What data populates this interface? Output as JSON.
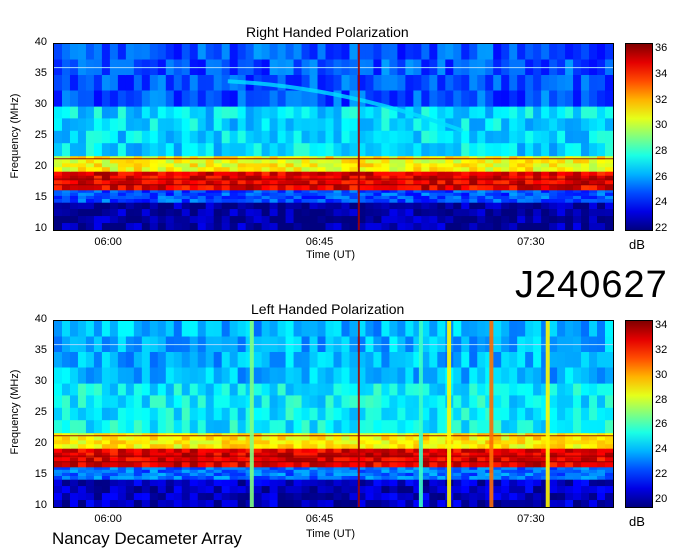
{
  "observation_id": "J240627",
  "footer": "Nancay Decameter Array",
  "colors": {
    "background": "#00007f",
    "low": "#00007f",
    "mid": "#00c8ff",
    "high": "#ffff00",
    "peak": "#8b0000"
  },
  "chart_data": [
    {
      "type": "heatmap",
      "title": "Right Handed Polarization",
      "xlabel": "Time (UT)",
      "ylabel": "Frequency (MHz)",
      "x_ticks": [
        "06:00",
        "06:45",
        "07:30"
      ],
      "y_ticks": [
        "10",
        "15",
        "20",
        "25",
        "30",
        "35",
        "40"
      ],
      "ylim": [
        10,
        40
      ],
      "xlim": [
        "05:48",
        "07:47"
      ],
      "colorbar": {
        "label": "dB",
        "ticks": [
          "36",
          "34",
          "32",
          "30",
          "28",
          "26",
          "24",
          "22"
        ],
        "range": [
          22,
          36.5
        ]
      },
      "bands": [
        {
          "freq": [
            10,
            14.5
          ],
          "level": 22.5
        },
        {
          "freq": [
            14.5,
            16.5
          ],
          "level": 25
        },
        {
          "freq": [
            16.5,
            19.5
          ],
          "level": 35
        },
        {
          "freq": [
            19.5,
            22
          ],
          "level": 31
        },
        {
          "freq": [
            22,
            30
          ],
          "level": 27
        },
        {
          "freq": [
            30,
            40
          ],
          "level": 25
        }
      ],
      "vertical_events": [
        {
          "time": "06:53",
          "level": 36
        }
      ],
      "drifting_feature": {
        "start": [
          "06:25",
          34
        ],
        "end": [
          "07:15",
          26
        ],
        "level": 27
      }
    },
    {
      "type": "heatmap",
      "title": "Left Handed Polarization",
      "xlabel": "Time (UT)",
      "ylabel": "Frequency (MHz)",
      "x_ticks": [
        "06:00",
        "06:45",
        "07:30"
      ],
      "y_ticks": [
        "10",
        "15",
        "20",
        "25",
        "30",
        "35",
        "40"
      ],
      "ylim": [
        10,
        40
      ],
      "xlim": [
        "05:48",
        "07:47"
      ],
      "colorbar": {
        "label": "dB",
        "ticks": [
          "34",
          "32",
          "30",
          "28",
          "26",
          "24",
          "22",
          "20"
        ],
        "range": [
          19.5,
          34.5
        ]
      },
      "bands": [
        {
          "freq": [
            10,
            14.5
          ],
          "level": 20.5
        },
        {
          "freq": [
            14.5,
            16.5
          ],
          "level": 23
        },
        {
          "freq": [
            16.5,
            19.5
          ],
          "level": 33
        },
        {
          "freq": [
            19.5,
            22
          ],
          "level": 29
        },
        {
          "freq": [
            22,
            30
          ],
          "level": 25
        },
        {
          "freq": [
            30,
            40
          ],
          "level": 24
        }
      ],
      "vertical_events": [
        {
          "time": "06:30",
          "level": 27
        },
        {
          "time": "06:53",
          "level": 34
        },
        {
          "time": "07:06",
          "level": 26
        },
        {
          "time": "07:12",
          "level": 29
        },
        {
          "time": "07:21",
          "level": 31
        },
        {
          "time": "07:33",
          "level": 29
        }
      ]
    }
  ]
}
